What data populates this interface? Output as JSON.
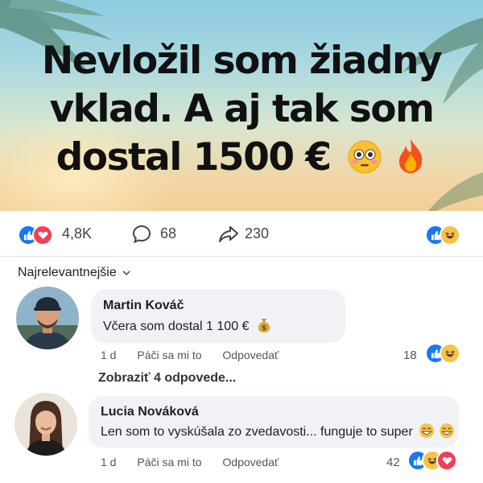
{
  "headline": {
    "line1": "Nevložil som žiadny",
    "line2": "vklad. A aj tak som",
    "line3": "dostal 1500 €"
  },
  "stats": {
    "reactions": "4,8K",
    "comments": "68",
    "shares": "230"
  },
  "sort": {
    "label": "Najrelevantnejšie"
  },
  "comments": [
    {
      "name": "Martin Kováč",
      "text": "Včera som dostal 1 100 €",
      "time": "1 d",
      "like": "Páči sa mi to",
      "reply": "Odpovedať",
      "reaction_count": "18"
    },
    {
      "name": "Lucia Nováková",
      "text": "Len som to vyskúšala zo zvedavosti... funguje to super",
      "time": "1 d",
      "like": "Páči sa mi to",
      "reply": "Odpovedať",
      "reaction_count": "42"
    }
  ],
  "replies_link": "Zobraziť 4 odpovede...",
  "colors": {
    "like": "#1877f2",
    "love": "#f33e58",
    "haha": "#f7c342",
    "bubble": "#f0f2f5"
  }
}
